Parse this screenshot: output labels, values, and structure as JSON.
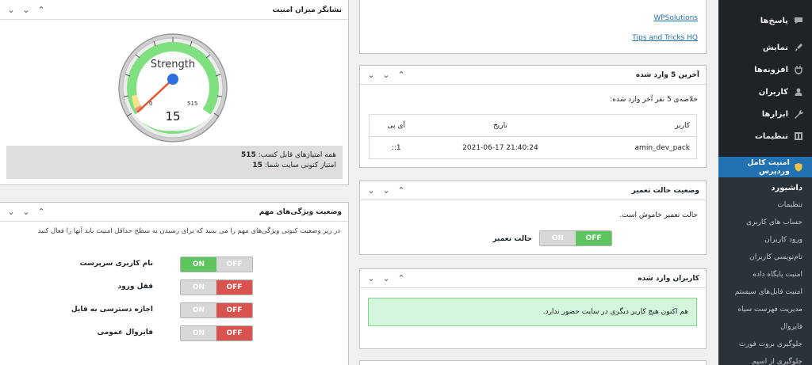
{
  "sidebar": {
    "items": [
      {
        "label": "پاسخ‌ها",
        "icon": "comment-icon"
      },
      {
        "label": "نمایش",
        "icon": "brush-icon"
      },
      {
        "label": "افزونه‌ها",
        "icon": "plugin-icon"
      },
      {
        "label": "کاربران",
        "icon": "user-icon"
      },
      {
        "label": "ابزارها",
        "icon": "wrench-icon"
      },
      {
        "label": "تنظیمات",
        "icon": "settings-icon"
      }
    ],
    "active": "امنیت کامل وردپرس",
    "submenu": [
      "داشبورد",
      "تنظیمات",
      "حساب های کاربری",
      "ورود کاربران",
      "نام‌نویسی کاربران",
      "امنیت پایگاه داده",
      "امنیت فایل‌های سیستم",
      "مدیریت فهرست سیاه",
      "فایروال",
      "جلوگیری بروت فورث",
      "جلوگیری از اسپم"
    ]
  },
  "strength_panel": {
    "title": "نشانگر میزان امنیت",
    "gauge_label": "Strength",
    "gauge_min": "0",
    "gauge_max": "515",
    "gauge_value": "15",
    "value_fraction": 0.029,
    "total_label": "همه امتیازهای قابل کسب:",
    "total_value": "515",
    "current_label": "امتیاز کنونی سایت شما:",
    "current_value": "15"
  },
  "features_panel": {
    "title": "وضعیت ویژگی‌های مهم",
    "description": "در زیر وضعیت کنونی ویژگی‌های مهم را می بینید که برای رسیدن به سطح حداقل امنیت باید آنها را فعال کنید",
    "rows": [
      {
        "label": "نام کاربری سرپرست",
        "on": "ON",
        "off": "OFF",
        "state": "on"
      },
      {
        "label": "قفل ورود",
        "on": "ON",
        "off": "OFF",
        "state": "off"
      },
      {
        "label": "اجازه دسترسی به فایل",
        "on": "ON",
        "off": "OFF",
        "state": "off"
      },
      {
        "label": "فایروال عمومی",
        "on": "ON",
        "off": "OFF",
        "state": "off"
      }
    ]
  },
  "links_panel": {
    "links": [
      "WPSolutions",
      "Tips and Tricks HQ"
    ]
  },
  "last_logins_panel": {
    "title": "آخرین 5 وارد شده",
    "summary": "خلاصه‌ی 5 نفر آخر وارد شده:",
    "columns": [
      "کاربر",
      "تاریخ",
      "آی پی"
    ],
    "rows": [
      {
        "user": "amin_dev_pack",
        "date": "2021-06-17 21:40:24",
        "ip": "::1"
      }
    ]
  },
  "maintenance_panel": {
    "title": "وضعیت حالت تعمیر",
    "status_text": "حالت تعمیر خاموش است.",
    "toggle_label": "حالت تعمیر",
    "on": "ON",
    "off": "OFF"
  },
  "logged_in_panel": {
    "title": "کاربران وارد شده",
    "notice": "هم اکنون هیچ کاربر دیگری در سایت حضور ندارد."
  },
  "colors": {
    "sidebar_bg": "#1d2327",
    "accent": "#2271b1",
    "on_green": "#5ec55e",
    "off_red": "#d9534f",
    "gauge_green": "#7ee07e"
  }
}
